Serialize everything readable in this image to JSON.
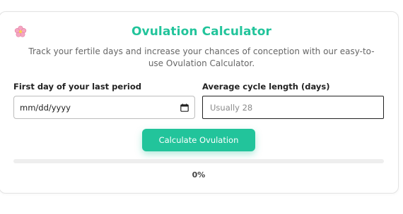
{
  "header": {
    "title": "Ovulation Calculator",
    "subtitle": "Track your fertile days and increase your chances of conception with our easy-to-use Ovulation Calculator.",
    "icon": "cherry-blossom-icon",
    "accent_color": "#22c49b"
  },
  "form": {
    "period_label": "First day of your last period",
    "period_value": "mm/dd/yyyy",
    "cycle_label": "Average cycle length (days)",
    "cycle_placeholder": "Usually 28",
    "cycle_value": ""
  },
  "actions": {
    "calculate_label": "Calculate Ovulation"
  },
  "progress": {
    "value": 0,
    "text": "0%"
  }
}
